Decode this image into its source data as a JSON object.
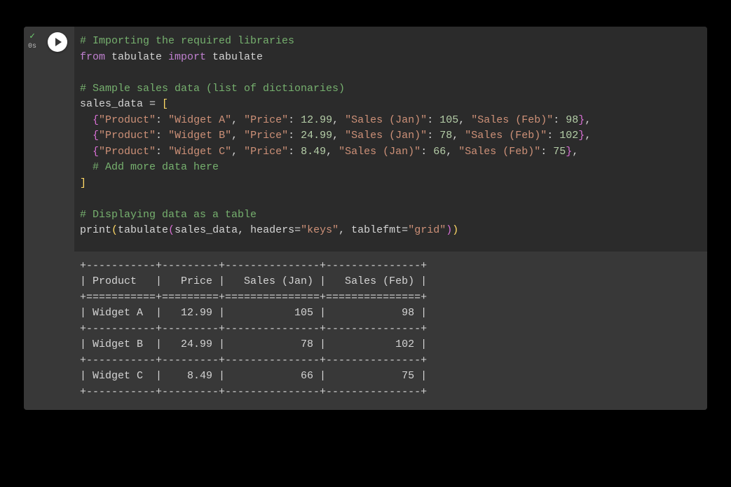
{
  "cell": {
    "status_icon": "✓",
    "exec_time": "0s"
  },
  "code": {
    "c1": "# Importing the required libraries",
    "kw_from": "from",
    "mod": " tabulate ",
    "kw_import": "import",
    "mod2": " tabulate",
    "c2": "# Sample sales data (list of dictionaries)",
    "var": "sales_data ",
    "eq": "= ",
    "ob": "[",
    "row_lb": "{",
    "row_rb": "}",
    "k_product": "\"Product\"",
    "k_price": "\"Price\"",
    "k_jan": "\"Sales (Jan)\"",
    "k_feb": "\"Sales (Feb)\"",
    "colon": ": ",
    "comma": ", ",
    "commaEnd": ",",
    "v1_prod": "\"Widget A\"",
    "v1_price": "12.99",
    "v1_jan": "105",
    "v1_feb": "98",
    "v2_prod": "\"Widget B\"",
    "v2_price": "24.99",
    "v2_jan": "78",
    "v2_feb": "102",
    "v3_prod": "\"Widget C\"",
    "v3_price": "8.49",
    "v3_jan": "66",
    "v3_feb": "75",
    "c3": "# Add more data here",
    "cb": "]",
    "c4": "# Displaying data as a table",
    "print": "print",
    "lp_y": "(",
    "rp_y": ")",
    "tabfn": "tabulate",
    "lp_p": "(",
    "rp_p": ")",
    "arg1": "sales_data",
    "arg2k": "headers",
    "arg2v": "\"keys\"",
    "arg3k": "tablefmt",
    "arg3v": "\"grid\""
  },
  "output": {
    "l01": "+-----------+---------+---------------+---------------+",
    "l02": "| Product   |   Price |   Sales (Jan) |   Sales (Feb) |",
    "l03": "+===========+=========+===============+===============+",
    "l04": "| Widget A  |   12.99 |           105 |            98 |",
    "l05": "+-----------+---------+---------------+---------------+",
    "l06": "| Widget B  |   24.99 |            78 |           102 |",
    "l07": "+-----------+---------+---------------+---------------+",
    "l08": "| Widget C  |    8.49 |            66 |            75 |",
    "l09": "+-----------+---------+---------------+---------------+"
  },
  "chart_data": {
    "type": "table",
    "title": "",
    "columns": [
      "Product",
      "Price",
      "Sales (Jan)",
      "Sales (Feb)"
    ],
    "rows": [
      [
        "Widget A",
        12.99,
        105,
        98
      ],
      [
        "Widget B",
        24.99,
        78,
        102
      ],
      [
        "Widget C",
        8.49,
        66,
        75
      ]
    ]
  }
}
